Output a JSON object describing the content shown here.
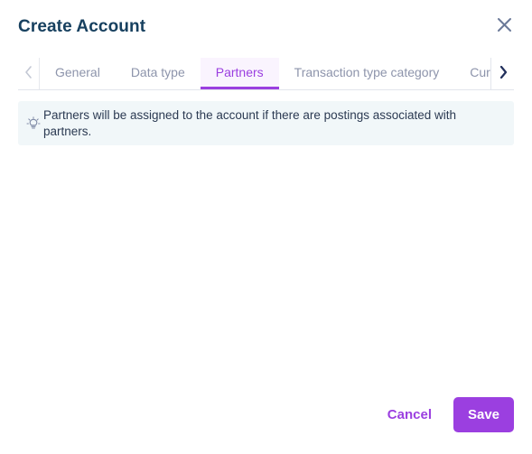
{
  "dialog": {
    "title": "Create Account",
    "close_icon": "close-icon"
  },
  "tabs": {
    "scroll_left_icon": "chevron-left-icon",
    "scroll_right_icon": "chevron-right-icon",
    "items": [
      {
        "label": "General",
        "active": false
      },
      {
        "label": "Data type",
        "active": false
      },
      {
        "label": "Partners",
        "active": true
      },
      {
        "label": "Transaction type category",
        "active": false
      },
      {
        "label": "Curre",
        "active": false
      }
    ],
    "active_tab": "Partners"
  },
  "hint": {
    "icon": "lightbulb-idea-icon",
    "text": "Partners will be assigned to the account if there are postings associated with partners."
  },
  "footer": {
    "cancel_label": "Cancel",
    "save_label": "Save"
  },
  "colors": {
    "accent_purple": "#9b3fe0",
    "title_navy": "#17405f",
    "tab_inactive": "#8d94ab",
    "hint_bg": "#f1f7f9",
    "active_tab_bg": "#faf4fe"
  }
}
